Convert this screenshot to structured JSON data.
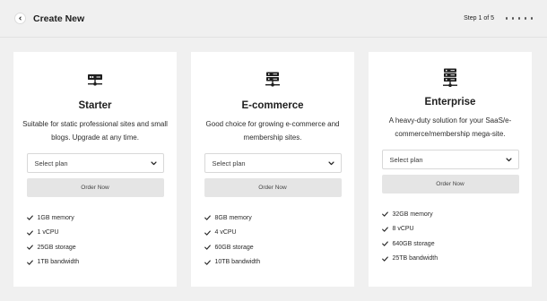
{
  "header": {
    "title": "Create New",
    "step": "Step 1 of 5",
    "dot_count": 5
  },
  "colors": {
    "background": "#f0f0f0",
    "card": "#ffffff",
    "button": "#e5e5e5",
    "text": "#1e1e1e"
  },
  "plans": [
    {
      "name": "Starter",
      "icon": "server-icon",
      "description": "Suitable for static professional sites and small blogs. Upgrade at any time.",
      "select_label": "Select plan",
      "order_label": "Order Now",
      "features": [
        "1GB memory",
        "1 vCPU",
        "25GB storage",
        "1TB bandwidth"
      ]
    },
    {
      "name": "E-commerce",
      "icon": "server-icon",
      "description": "Good choice for growing e-commerce and membership sites.",
      "select_label": "Select plan",
      "order_label": "Order Now",
      "features": [
        "8GB memory",
        "4 vCPU",
        "60GB storage",
        "10TB bandwidth"
      ]
    },
    {
      "name": "Enterprise",
      "icon": "server-icon",
      "description": "A heavy-duty solution for your SaaS/e-commerce/membership mega-site.",
      "select_label": "Select plan",
      "order_label": "Order Now",
      "features": [
        "32GB memory",
        "8 vCPU",
        "640GB storage",
        "25TB bandwidth"
      ]
    }
  ]
}
